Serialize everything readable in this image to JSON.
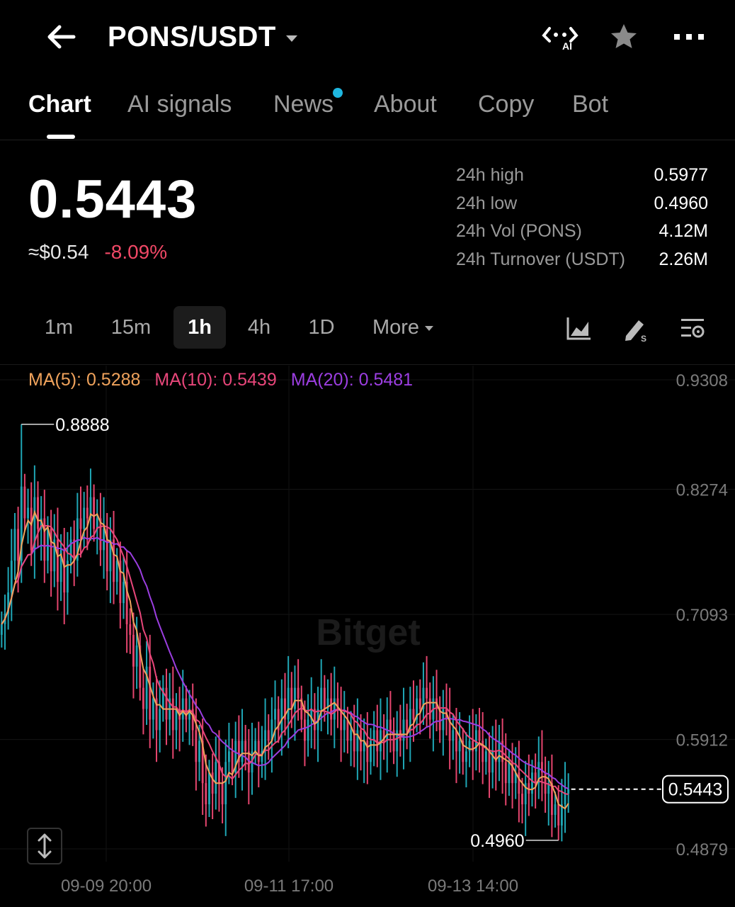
{
  "header": {
    "pair": "PONS/USDT",
    "ai_badge": "AI"
  },
  "tabs": [
    {
      "label": "Chart",
      "active": true
    },
    {
      "label": "AI signals"
    },
    {
      "label": "News"
    },
    {
      "label": "About"
    },
    {
      "label": "Copy"
    },
    {
      "label": "Bot"
    }
  ],
  "ticker": {
    "price": "0.5443",
    "usd": "≈$0.54",
    "change": "-8.09%",
    "stats": [
      {
        "label": "24h high",
        "value": "0.5977"
      },
      {
        "label": "24h low",
        "value": "0.4960"
      },
      {
        "label": "24h Vol (PONS)",
        "value": "4.12M"
      },
      {
        "label": "24h Turnover (USDT)",
        "value": "2.26M"
      }
    ]
  },
  "timeframes": [
    {
      "label": "1m"
    },
    {
      "label": "15m"
    },
    {
      "label": "1h",
      "active": true
    },
    {
      "label": "4h"
    },
    {
      "label": "1D"
    },
    {
      "label": "More"
    }
  ],
  "indicators": {
    "ma5": "MA(5): 0.5288",
    "ma10": "MA(10): 0.5439",
    "ma20": "MA(20): 0.5481"
  },
  "colors": {
    "up": "#1fa6b5",
    "down": "#e5456e",
    "ma5": "#f0a35c",
    "ma10": "#e8467a",
    "ma20": "#9b3ee0",
    "news_dot": "#1fb7e0",
    "negative": "#f04866"
  },
  "chart_data": {
    "type": "candlestick",
    "y_axis_labels": [
      "0.9308",
      "0.8274",
      "0.7093",
      "0.5912",
      "0.4879"
    ],
    "ylim": [
      0.4879,
      0.9308
    ],
    "x_axis_labels": [
      "09-09 20:00",
      "09-11 17:00",
      "09-13 14:00"
    ],
    "max_marker": "0.8888",
    "min_marker": "0.4960",
    "last_price": "0.5443",
    "watermark": "Bitget",
    "close": [
      0.7,
      0.71,
      0.73,
      0.76,
      0.79,
      0.76,
      0.83,
      0.8,
      0.81,
      0.77,
      0.82,
      0.79,
      0.8,
      0.76,
      0.79,
      0.75,
      0.78,
      0.74,
      0.77,
      0.73,
      0.76,
      0.78,
      0.76,
      0.8,
      0.79,
      0.81,
      0.8,
      0.82,
      0.79,
      0.8,
      0.77,
      0.79,
      0.75,
      0.78,
      0.74,
      0.76,
      0.72,
      0.74,
      0.7,
      0.69,
      0.66,
      0.68,
      0.64,
      0.62,
      0.66,
      0.61,
      0.63,
      0.6,
      0.62,
      0.64,
      0.61,
      0.63,
      0.6,
      0.62,
      0.61,
      0.63,
      0.61,
      0.62,
      0.6,
      0.57,
      0.59,
      0.55,
      0.53,
      0.56,
      0.54,
      0.57,
      0.55,
      0.53,
      0.57,
      0.58,
      0.56,
      0.59,
      0.57,
      0.59,
      0.58,
      0.56,
      0.58,
      0.59,
      0.57,
      0.58,
      0.6,
      0.59,
      0.61,
      0.62,
      0.6,
      0.63,
      0.61,
      0.64,
      0.62,
      0.64,
      0.63,
      0.61,
      0.59,
      0.61,
      0.62,
      0.6,
      0.62,
      0.64,
      0.62,
      0.63,
      0.61,
      0.63,
      0.62,
      0.6,
      0.61,
      0.59,
      0.6,
      0.58,
      0.6,
      0.58,
      0.59,
      0.57,
      0.59,
      0.6,
      0.58,
      0.6,
      0.59,
      0.61,
      0.6,
      0.58,
      0.6,
      0.59,
      0.61,
      0.6,
      0.62,
      0.61,
      0.63,
      0.62,
      0.64,
      0.63,
      0.61,
      0.63,
      0.62,
      0.6,
      0.62,
      0.61,
      0.59,
      0.6,
      0.58,
      0.59,
      0.57,
      0.58,
      0.59,
      0.58,
      0.6,
      0.59,
      0.57,
      0.58,
      0.56,
      0.58,
      0.57,
      0.59,
      0.57,
      0.55,
      0.57,
      0.55,
      0.56,
      0.54,
      0.53,
      0.55,
      0.54,
      0.56,
      0.55,
      0.57,
      0.56,
      0.54,
      0.55,
      0.52,
      0.53,
      0.51,
      0.53,
      0.54,
      0.5443
    ]
  }
}
